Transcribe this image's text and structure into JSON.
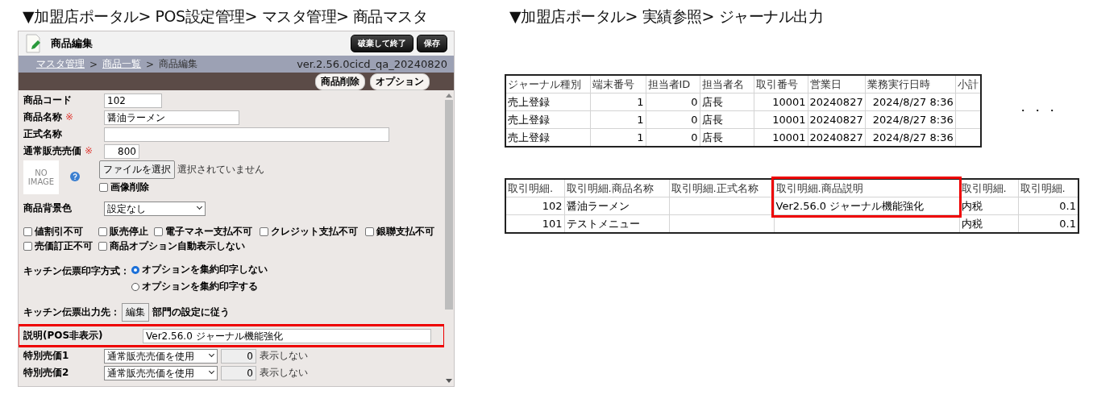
{
  "left": {
    "caption": "▼加盟店ポータル> POS設定管理> マスタ管理> 商品マスタ",
    "window": {
      "title": "商品編集",
      "buttons": [
        "破棄して終了",
        "保存"
      ],
      "breadcrumb": [
        {
          "kind": "link",
          "label": "マスタ管理"
        },
        {
          "kind": "sep",
          "label": ">"
        },
        {
          "kind": "link",
          "label": "商品一覧"
        },
        {
          "kind": "sep",
          "label": ">"
        },
        {
          "kind": "current",
          "label": "商品編集"
        }
      ],
      "version": "ver.2.56.0cicd_qa_20240820",
      "toolbar_buttons": [
        "商品削除",
        "オプション"
      ],
      "form": [
        {
          "kind": "short",
          "label": "商品コード",
          "value": "102"
        },
        {
          "kind": "medium",
          "label": "商品名称",
          "required_mark": "※",
          "value": "醤油ラーメン"
        },
        {
          "kind": "long",
          "label": "正式名称"
        },
        {
          "kind": "number",
          "label": "通常販売売価",
          "required_mark": "※",
          "value": "800"
        },
        {
          "kind": "image",
          "no_image": "NO IMAGE",
          "file_button": "ファイルを選択",
          "file_status": "選択されていません",
          "checkbox": {
            "label": "画像削除",
            "checked": false
          }
        },
        {
          "kind": "select",
          "label": "商品背景色",
          "value": "設定なし"
        },
        {
          "kind": "checks",
          "items": [
            {
              "label": "値割引不可",
              "checked": false
            },
            {
              "label": "販売停止",
              "checked": false
            },
            {
              "label": "電子マネー支払不可",
              "checked": false
            },
            {
              "label": "クレジット支払不可",
              "checked": false
            },
            {
              "label": "銀聯支払不可",
              "checked": false
            },
            {
              "label": "売価訂正不可",
              "checked": false
            },
            {
              "label": "商品オプション自動表示しない",
              "checked": false
            }
          ]
        },
        {
          "kind": "radio",
          "label": "キッチン伝票印字方式：",
          "options": [
            {
              "label": "オプションを集約印字しない",
              "selected": true
            },
            {
              "label": "オプションを集約印字する",
              "selected": false
            }
          ]
        },
        {
          "kind": "button",
          "label": "キッチン伝票出力先：",
          "button": "編集",
          "note": "部門の設定に従う"
        },
        {
          "kind": "wide",
          "label": "説明(POS非表示)",
          "value": "Ver2.56.0 ジャーナル機能強化",
          "highlighted": true
        },
        {
          "kind": "special",
          "label": "特別売価1",
          "select": "通常販売売価を使用",
          "amount": "0",
          "note": "表示しない"
        },
        {
          "kind": "special",
          "label": "特別売価2",
          "select": "通常販売売価を使用",
          "amount": "0",
          "note": "表示しない"
        }
      ]
    }
  },
  "right": {
    "caption": "▼加盟店ポータル> 実績参照> ジャーナル出力",
    "journal_table": {
      "columns": [
        {
          "label": "ジャーナル種別"
        },
        {
          "label": "端末番号"
        },
        {
          "label": "担当者ID"
        },
        {
          "label": "担当者名"
        },
        {
          "label": "取引番号"
        },
        {
          "label": "営業日"
        },
        {
          "label": "業務実行日時"
        },
        {
          "label": "小計"
        }
      ],
      "rows": [
        [
          "売上登録",
          "1",
          "0",
          "店長",
          "10001",
          "20240827",
          "2024/8/27 8:36",
          ""
        ],
        [
          "売上登録",
          "1",
          "0",
          "店長",
          "10001",
          "20240827",
          "2024/8/27 8:36",
          ""
        ],
        [
          "売上登録",
          "1",
          "0",
          "店長",
          "10001",
          "20240827",
          "2024/8/27 8:36",
          ""
        ]
      ]
    },
    "ellipsis": "・・・",
    "detail_table": {
      "columns": [
        {
          "label": "取引明細."
        },
        {
          "label": "取引明細.商品名称"
        },
        {
          "label": "取引明細.正式名称"
        },
        {
          "label": "取引明細.商品説明",
          "highlighted": true
        },
        {
          "label": "取引明細."
        },
        {
          "label": "取引明細."
        }
      ],
      "rows": [
        {
          "highlighted": true,
          "cells": [
            "102",
            "醤油ラーメン",
            "",
            "Ver2.56.0 ジャーナル機能強化",
            "内税",
            "0.1"
          ]
        },
        {
          "cells": [
            "101",
            "テストメニュー",
            "",
            "",
            "内税",
            "0.1"
          ]
        }
      ]
    }
  }
}
